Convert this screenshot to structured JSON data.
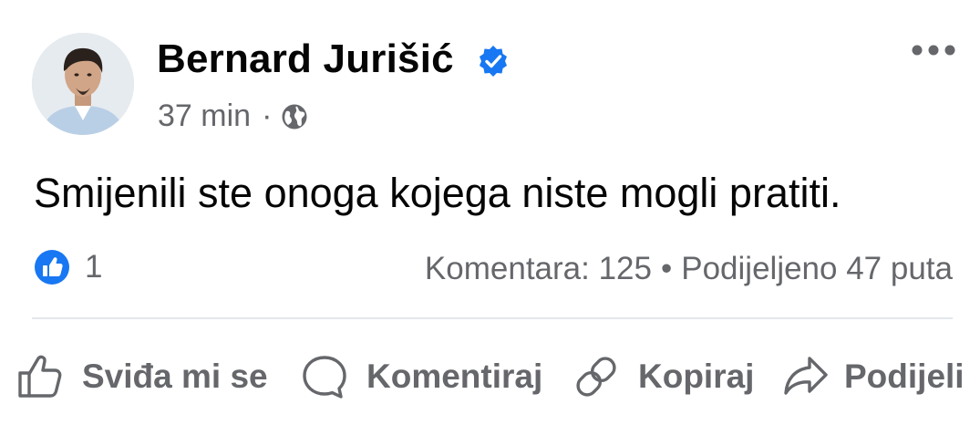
{
  "post": {
    "author": {
      "name": "Bernard Jurišić",
      "verified": true
    },
    "time": "37 min",
    "visibility_icon": "globe-icon",
    "text": "Smijenili ste onoga kojega niste mogli pratiti.",
    "reactions": {
      "icon": "like-icon",
      "count": "1"
    },
    "stats": {
      "comments": "Komentara: 125",
      "separator": "•",
      "shares": "Podijeljeno 47 puta"
    }
  },
  "actions": {
    "like": "Sviđa mi se",
    "comment": "Komentiraj",
    "copy": "Kopiraj",
    "share": "Podijeli"
  },
  "colors": {
    "accent": "#1877f2",
    "text_primary": "#050505",
    "text_secondary": "#65676b",
    "divider": "#e4e6eb"
  }
}
